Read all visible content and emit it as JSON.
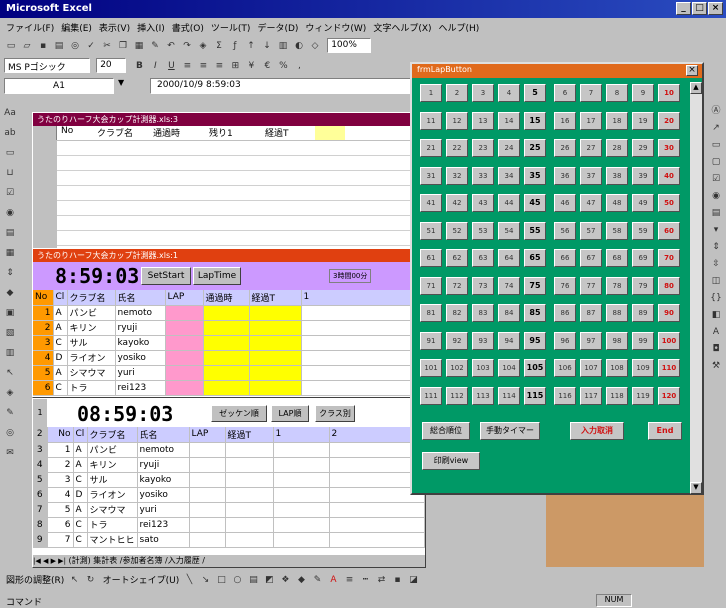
{
  "app": {
    "title": "Microsoft Excel",
    "min": "_",
    "max": "□",
    "close": "×"
  },
  "menu": [
    "ファイル(F)",
    "編集(E)",
    "表示(V)",
    "挿入(I)",
    "書式(O)",
    "ツール(T)",
    "データ(D)",
    "ウィンドウ(W)",
    "文字ヘルプ(X)",
    "ヘルプ(H)"
  ],
  "toolbar1": {
    "zoom": "100%"
  },
  "toolbar2": {
    "font": "MS Pゴシック",
    "size": "20"
  },
  "formula": {
    "cell": "A1",
    "value": "2000/10/9 8:59:03"
  },
  "win1": {
    "title": "うたのりハーフ大会カップ計測器.xls:3",
    "headers": [
      "No",
      "クラブ名",
      "通過時",
      "残り1",
      "経過T"
    ]
  },
  "win2": {
    "title": "うたのりハーフ大会カップ計測器.xls:1",
    "clock": "8:59:03",
    "set_start": "SetStart",
    "lap_time": "LapTime",
    "duration": "3時間00分",
    "headers": [
      "No",
      "Cl",
      "クラブ名",
      "氏名",
      "LAP",
      "通過時",
      "経過T",
      "1"
    ],
    "rows": [
      [
        "1",
        "A",
        "パンビ",
        "nemoto"
      ],
      [
        "2",
        "A",
        "キリン",
        "ryuji"
      ],
      [
        "3",
        "C",
        "サル",
        "kayoko"
      ],
      [
        "4",
        "D",
        "ライオン",
        "yosiko"
      ],
      [
        "5",
        "A",
        "シマウマ",
        "yuri"
      ],
      [
        "6",
        "C",
        "トラ",
        "rei123"
      ]
    ]
  },
  "win3": {
    "clock": "08:59:03",
    "btn_zekken": "ゼッケン順",
    "btn_lap": "LAP順",
    "btn_class": "クラス別",
    "headers": [
      "No",
      "Cl",
      "クラブ名",
      "氏名",
      "LAP",
      "経過T",
      "1",
      "2"
    ],
    "rownums": [
      "1",
      "2",
      "3",
      "4",
      "5",
      "6",
      "7",
      "8",
      "9"
    ],
    "rows": [
      [
        "1",
        "A",
        "パンビ",
        "nemoto"
      ],
      [
        "2",
        "A",
        "キリン",
        "ryuji"
      ],
      [
        "3",
        "C",
        "サル",
        "kayoko"
      ],
      [
        "4",
        "D",
        "ライオン",
        "yosiko"
      ],
      [
        "5",
        "A",
        "シマウマ",
        "yuri"
      ],
      [
        "6",
        "C",
        "トラ",
        "rei123"
      ],
      [
        "7",
        "C",
        "マントヒヒ",
        "sato"
      ]
    ],
    "tabs": "(計測) 集計表 /参加者名簿 /入力履歴 /"
  },
  "palette": {
    "title": "frmLapButton",
    "close": "×",
    "buttons": [
      "1",
      "2",
      "3",
      "4",
      "5",
      "6",
      "7",
      "8",
      "9",
      "10",
      "11",
      "12",
      "13",
      "14",
      "15",
      "16",
      "17",
      "18",
      "19",
      "20",
      "21",
      "22",
      "23",
      "24",
      "25",
      "26",
      "27",
      "28",
      "29",
      "30",
      "31",
      "32",
      "33",
      "34",
      "35",
      "36",
      "37",
      "38",
      "39",
      "40",
      "41",
      "42",
      "43",
      "44",
      "45",
      "46",
      "47",
      "48",
      "49",
      "50",
      "51",
      "52",
      "53",
      "54",
      "55",
      "56",
      "57",
      "58",
      "59",
      "60",
      "61",
      "62",
      "63",
      "64",
      "65",
      "66",
      "67",
      "68",
      "69",
      "70",
      "71",
      "72",
      "73",
      "74",
      "75",
      "76",
      "77",
      "78",
      "79",
      "80",
      "81",
      "82",
      "83",
      "84",
      "85",
      "86",
      "87",
      "88",
      "89",
      "90",
      "91",
      "92",
      "93",
      "94",
      "95",
      "96",
      "97",
      "98",
      "99",
      "100",
      "101",
      "102",
      "103",
      "104",
      "105",
      "106",
      "107",
      "108",
      "109",
      "110",
      "111",
      "112",
      "113",
      "114",
      "115",
      "116",
      "117",
      "118",
      "119",
      "120"
    ],
    "sogo": "総合順位",
    "shudo": "手動タイマー",
    "nyuryoku": "入力取消",
    "end": "End",
    "insatsu": "印刷view"
  },
  "drawbar": {
    "draw": "図形の調整(R)",
    "autoshape": "オートシェイプ(U)"
  },
  "status": {
    "left": "コマンド",
    "right": "NUM"
  },
  "colors": {
    "palette_bg": "#009966",
    "palette_title": "#e06a1c",
    "win_title": "#800040",
    "win2_title": "#e04010",
    "clock_bg": "#cc99ff",
    "lap_pink": "#ff99cc",
    "yellow": "#ffff00",
    "orange": "#ff9900"
  }
}
